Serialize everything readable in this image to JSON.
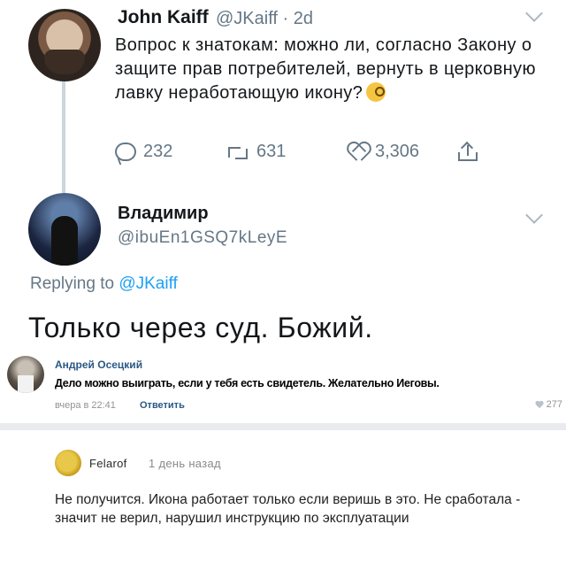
{
  "tweet1": {
    "author_name": "John Kaiff",
    "author_meta": "@JKaiff · 2d",
    "text": "Вопрос к знатокам: можно ли, согласно Закону о защите прав потребителей, вернуть в церковную лавку неработающую икону?",
    "emoji": "face-with-monocle",
    "replies": "232",
    "retweets": "631",
    "likes": "3,306"
  },
  "tweet2": {
    "author_name": "Владимир",
    "author_handle": "@ibuEn1GSQ7kLeyE",
    "replying_prefix": "Replying to",
    "replying_to": "@JKaiff",
    "text": "Только через суд. Божий."
  },
  "vk_comment": {
    "author": "Андрей Осецкий",
    "text": "Дело можно выиграть, если у тебя есть свидетель. Желательно Иеговы.",
    "date": "вчера в 22:41",
    "reply_label": "Ответить",
    "likes": "277"
  },
  "comment3": {
    "author": "Felarof",
    "time": "1 день назад",
    "text": "Не получится. Икона работает только если веришь в это. Не сработала - значит не верил, нарушил инструкцию по эксплуатации"
  },
  "colors": {
    "twitter_gray": "#657786",
    "twitter_blue": "#1da1f2",
    "vk_link": "#2a5885"
  }
}
